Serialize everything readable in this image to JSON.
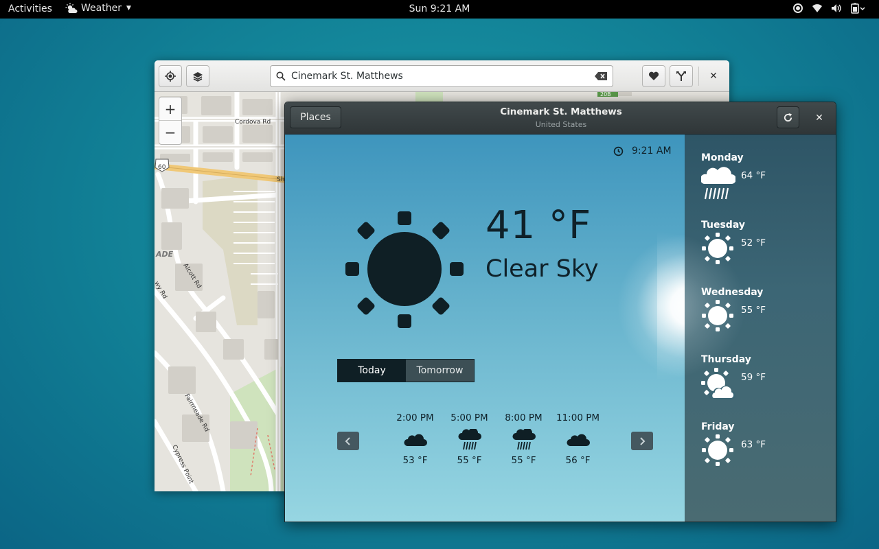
{
  "topbar": {
    "activities": "Activities",
    "app_name": "Weather",
    "clock": "Sun  9:21 AM"
  },
  "maps": {
    "search_value": "Cinemark St. Matthews",
    "zoom_in": "+",
    "zoom_out": "−",
    "road_labels": {
      "cordova": "Cordova Rd",
      "route": "60",
      "alcott": "Alcott Rd",
      "wy": "wy Rd",
      "fairmeade": "Fairmeade Rd",
      "cypress": "Cypress Point",
      "ade": "ADE",
      "sh": "Sh",
      "route_top": "20B"
    }
  },
  "weather": {
    "places_label": "Places",
    "title": "Cinemark St. Matthews",
    "subtitle": "United States",
    "time": "9:21 AM",
    "temperature": "41 °F",
    "condition": "Clear Sky",
    "tabs": [
      {
        "label": "Today",
        "active": true
      },
      {
        "label": "Tomorrow",
        "active": false
      }
    ],
    "hourly": [
      {
        "time": "2:00 PM",
        "temp": "53 °F",
        "icon": "cloud-icon"
      },
      {
        "time": "5:00 PM",
        "temp": "55 °F",
        "icon": "rain-icon"
      },
      {
        "time": "8:00 PM",
        "temp": "55 °F",
        "icon": "rain-icon"
      },
      {
        "time": "11:00 PM",
        "temp": "56 °F",
        "icon": "cloud-icon"
      }
    ],
    "forecast": [
      {
        "day": "Monday",
        "temp": "64 °F",
        "icon": "rain-icon"
      },
      {
        "day": "Tuesday",
        "temp": "52 °F",
        "icon": "sun-icon"
      },
      {
        "day": "Wednesday",
        "temp": "55 °F",
        "icon": "sun-icon"
      },
      {
        "day": "Thursday",
        "temp": "59 °F",
        "icon": "partly-cloudy-icon"
      },
      {
        "day": "Friday",
        "temp": "63 °F",
        "icon": "sun-icon"
      }
    ],
    "colors": {
      "dark_text": "#0f2129",
      "active_tab": "#0f1f25",
      "sidebar": "#3c6675"
    }
  }
}
